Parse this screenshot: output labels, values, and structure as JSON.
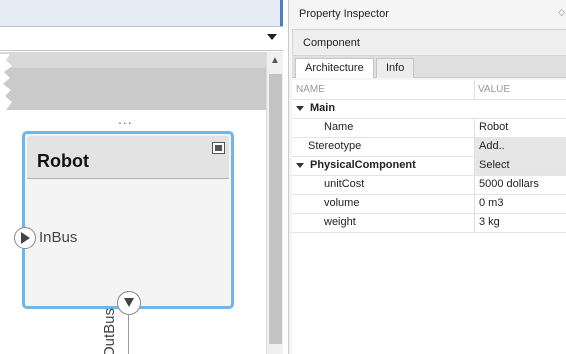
{
  "canvas": {
    "component": {
      "title": "Robot"
    },
    "in_port": {
      "label": "InBus"
    },
    "out_port": {
      "label": "OutBus"
    },
    "dots": "..."
  },
  "inspector": {
    "title": "Property Inspector",
    "close": "◇",
    "component_label": "Component",
    "tabs": [
      {
        "label": "Architecture",
        "active": true
      },
      {
        "label": "Info",
        "active": false
      }
    ],
    "columns": {
      "name": "NAME",
      "value": "VALUE"
    },
    "groups": {
      "main": {
        "label": "Main"
      },
      "physical": {
        "label": "PhysicalComponent",
        "value": "Select"
      }
    },
    "rows": {
      "name": {
        "label": "Name",
        "value": "Robot"
      },
      "stereotype": {
        "label": "Stereotype",
        "value": "Add.."
      },
      "unitCost": {
        "label": "unitCost",
        "value": "5000 dollars"
      },
      "volume": {
        "label": "volume",
        "value": "0 m3"
      },
      "weight": {
        "label": "weight",
        "value": "3 kg"
      }
    }
  }
}
